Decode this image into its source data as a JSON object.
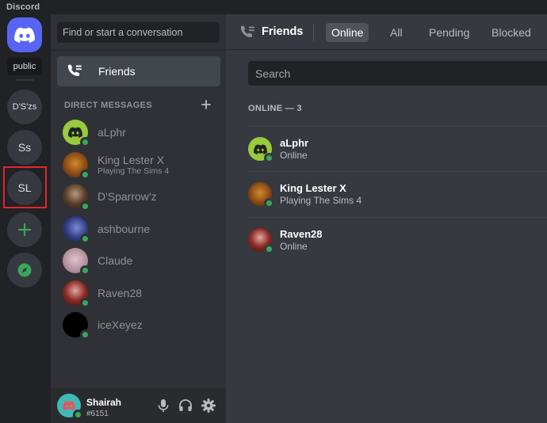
{
  "app": {
    "title": "Discord"
  },
  "rail": {
    "tooltip": "public",
    "servers": [
      {
        "label": "D'S'zs"
      },
      {
        "label": "Ss"
      },
      {
        "label": "SL"
      }
    ],
    "add_icon": "plus-icon",
    "explore_icon": "compass-icon"
  },
  "sidebar": {
    "search_placeholder": "Find or start a conversation",
    "friends_label": "Friends",
    "dm_header": "DIRECT MESSAGES",
    "dms": [
      {
        "name": "aLphr",
        "sub": "",
        "avatar": "discord-green"
      },
      {
        "name": "King Lester X",
        "sub": "Playing The Sims 4",
        "avatar": "lion"
      },
      {
        "name": "D'Sparrow'z",
        "sub": "",
        "avatar": "pirate"
      },
      {
        "name": "ashbourne",
        "sub": "",
        "avatar": "storm"
      },
      {
        "name": "Claude",
        "sub": "",
        "avatar": "claude"
      },
      {
        "name": "Raven28",
        "sub": "",
        "avatar": "raven"
      },
      {
        "name": "iceXeyez",
        "sub": "",
        "avatar": "black"
      }
    ]
  },
  "user": {
    "name": "Shairah",
    "tag": "#6151"
  },
  "main": {
    "title": "Friends",
    "tabs": [
      {
        "label": "Online",
        "active": true
      },
      {
        "label": "All",
        "active": false
      },
      {
        "label": "Pending",
        "active": false
      },
      {
        "label": "Blocked",
        "active": false
      }
    ],
    "search_placeholder": "Search",
    "online_header": "ONLINE — 3",
    "friends": [
      {
        "name": "aLphr",
        "status": "Online",
        "avatar": "discord-green"
      },
      {
        "name": "King Lester X",
        "status": "Playing The Sims 4",
        "avatar": "lion"
      },
      {
        "name": "Raven28",
        "status": "Online",
        "avatar": "raven"
      }
    ]
  },
  "colors": {
    "blurple": "#5865f2",
    "online": "#3ba55c",
    "highlight": "#e3262c"
  }
}
